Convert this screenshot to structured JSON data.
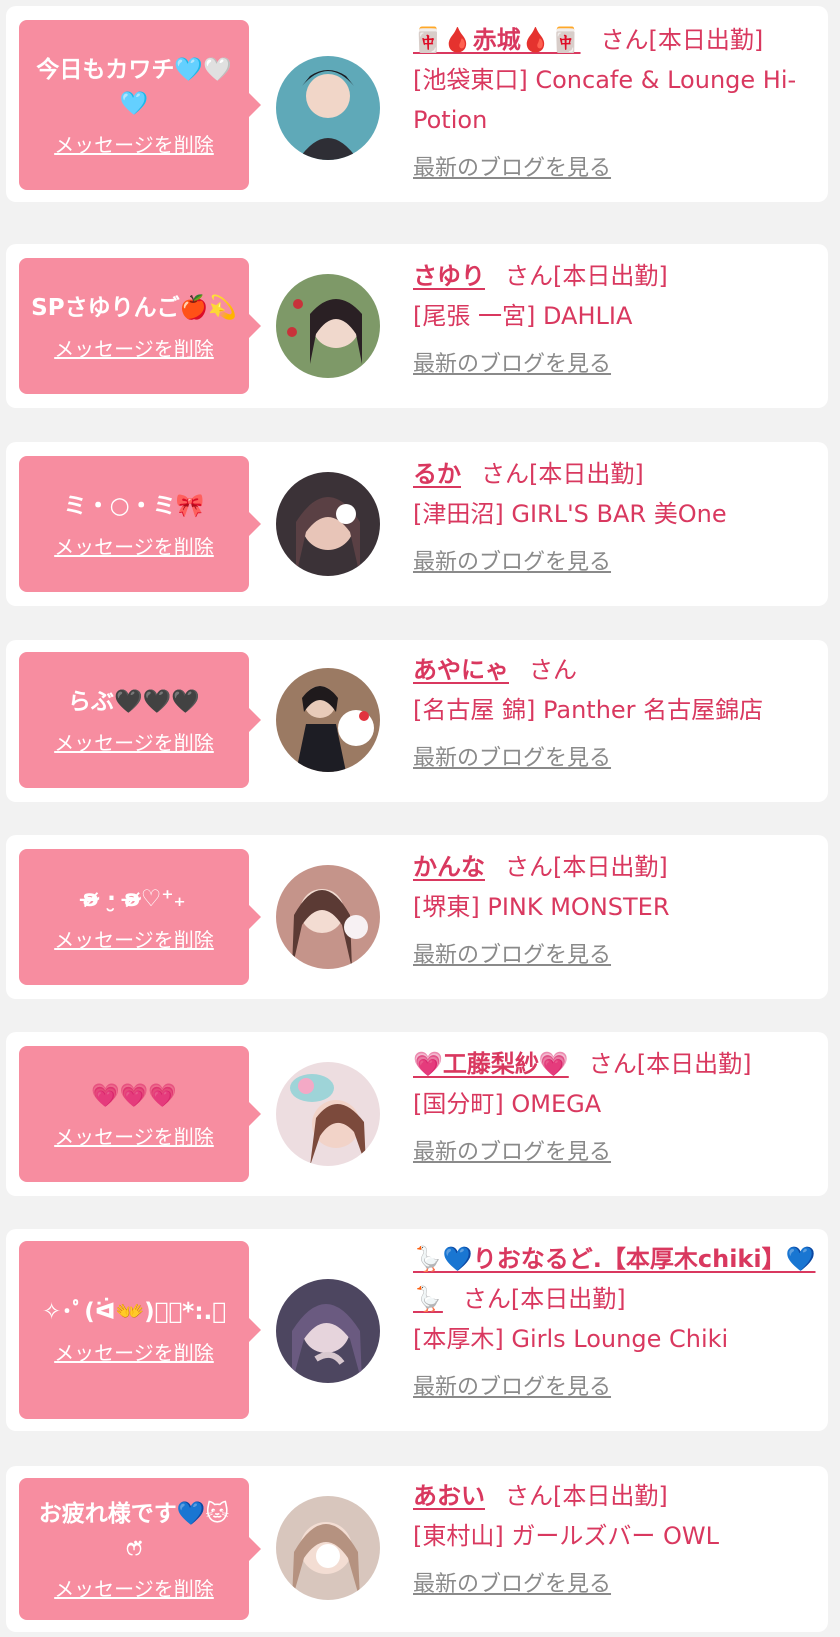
{
  "accent_color": "#d9385f",
  "bubble_color": "#f78da0",
  "delete_label": "メッセージを削除",
  "san_label": "さん",
  "blog_label": "最新のブログを見る",
  "entries": [
    {
      "message": "今日もカワチ🩵🤍🩵",
      "name": "🀄🩸赤城🩸🀄",
      "status": "[本日出勤]",
      "shop": "[池袋東口] Concafe & Lounge Hi-Potion",
      "avatar_color": "#5fa9b8"
    },
    {
      "message": "SPさゆりんご🍎💫",
      "name": "さゆり",
      "status": "[本日出勤]",
      "shop": "[尾張 一宮] DAHLIA",
      "avatar_color": "#7e9968"
    },
    {
      "message": "ミ・○・ミ🎀",
      "name": "るか",
      "status": "[本日出勤]",
      "shop": "[津田沼] GIRL'S BAR 美One",
      "avatar_color": "#7a5c55"
    },
    {
      "message": "らぶ🖤🖤🖤",
      "name": "あやにゃ",
      "status": "",
      "shop": "[名古屋 錦] Panther 名古屋錦店",
      "avatar_color": "#9b7a63"
    },
    {
      "message": "ʚ̴̶̷̷ ·̮ ʚ̴̶̷̷♡⁺₊",
      "name": "かんな",
      "status": "[本日出勤]",
      "shop": "[堺東] PINK MONSTER",
      "avatar_color": "#c5948a"
    },
    {
      "message": "💗💗💗",
      "name": "💗工藤梨紗💗",
      "status": "[本日出勤]",
      "shop": "[国分町] OMEGA",
      "avatar_color": "#d9a6b0"
    },
    {
      "message": "✧･ﾟ(ᐛ👐)ﾟ･*:.｡",
      "name": "🪿💙りおなるど.【本厚木chiki】💙🪿",
      "status": "[本日出勤]",
      "shop": "[本厚木] Girls Lounge Chiki",
      "avatar_color": "#6a5a80"
    },
    {
      "message": "お疲れ様です💙🐱ෆ̈",
      "name": "あおい",
      "status": "[本日出勤]",
      "shop": "[東村山] ガールズバー OWL",
      "avatar_color": "#b59280"
    }
  ]
}
